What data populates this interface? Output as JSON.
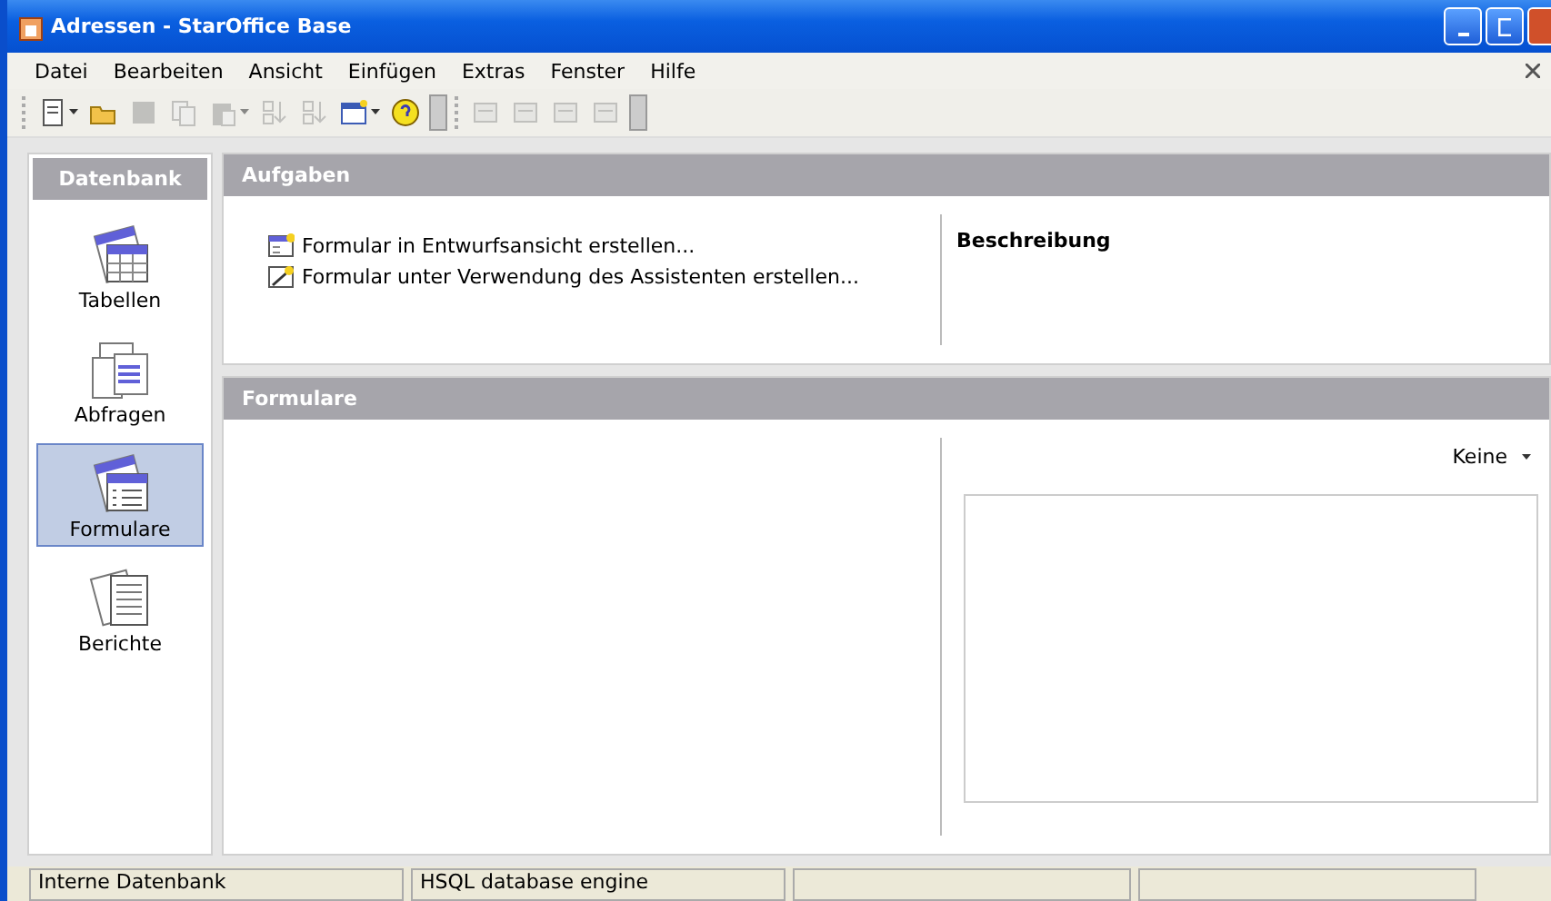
{
  "window": {
    "title": "Adressen - StarOffice Base"
  },
  "menu": [
    "Datei",
    "Bearbeiten",
    "Ansicht",
    "Einfügen",
    "Extras",
    "Fenster",
    "Hilfe"
  ],
  "toolbar": {
    "buttons": [
      {
        "kind": "new",
        "disabled": false,
        "dropdown": true
      },
      {
        "kind": "open",
        "disabled": false,
        "dropdown": false
      },
      {
        "kind": "save",
        "disabled": true,
        "dropdown": false
      },
      {
        "kind": "copy",
        "disabled": true,
        "dropdown": false
      },
      {
        "kind": "paste",
        "disabled": true,
        "dropdown": true
      },
      {
        "kind": "sort-asc",
        "disabled": true,
        "dropdown": false
      },
      {
        "kind": "sort-desc",
        "disabled": true,
        "dropdown": false
      },
      {
        "kind": "form",
        "disabled": false,
        "dropdown": true
      },
      {
        "kind": "help",
        "disabled": false,
        "dropdown": false
      },
      {
        "kind": "doc",
        "disabled": true,
        "dropdown": false
      },
      {
        "kind": "doc",
        "disabled": true,
        "dropdown": false
      },
      {
        "kind": "doc",
        "disabled": true,
        "dropdown": false
      },
      {
        "kind": "doc",
        "disabled": true,
        "dropdown": false
      }
    ]
  },
  "sidebar": {
    "title": "Datenbank",
    "items": [
      {
        "label": "Tabellen",
        "kind": "table",
        "selected": false
      },
      {
        "label": "Abfragen",
        "kind": "query",
        "selected": false
      },
      {
        "label": "Formulare",
        "kind": "form",
        "selected": true
      },
      {
        "label": "Berichte",
        "kind": "report",
        "selected": false
      }
    ]
  },
  "tasks": {
    "title": "Aufgaben",
    "items": [
      {
        "label": "Formular in Entwurfsansicht erstellen...",
        "kind": "design"
      },
      {
        "label": "Formular unter Verwendung des Assistenten erstellen...",
        "kind": "wizard"
      }
    ],
    "description_title": "Beschreibung"
  },
  "forms": {
    "title": "Formulare",
    "preview": "Keine"
  },
  "status_bar": [
    "Interne Datenbank",
    "HSQL database engine"
  ]
}
